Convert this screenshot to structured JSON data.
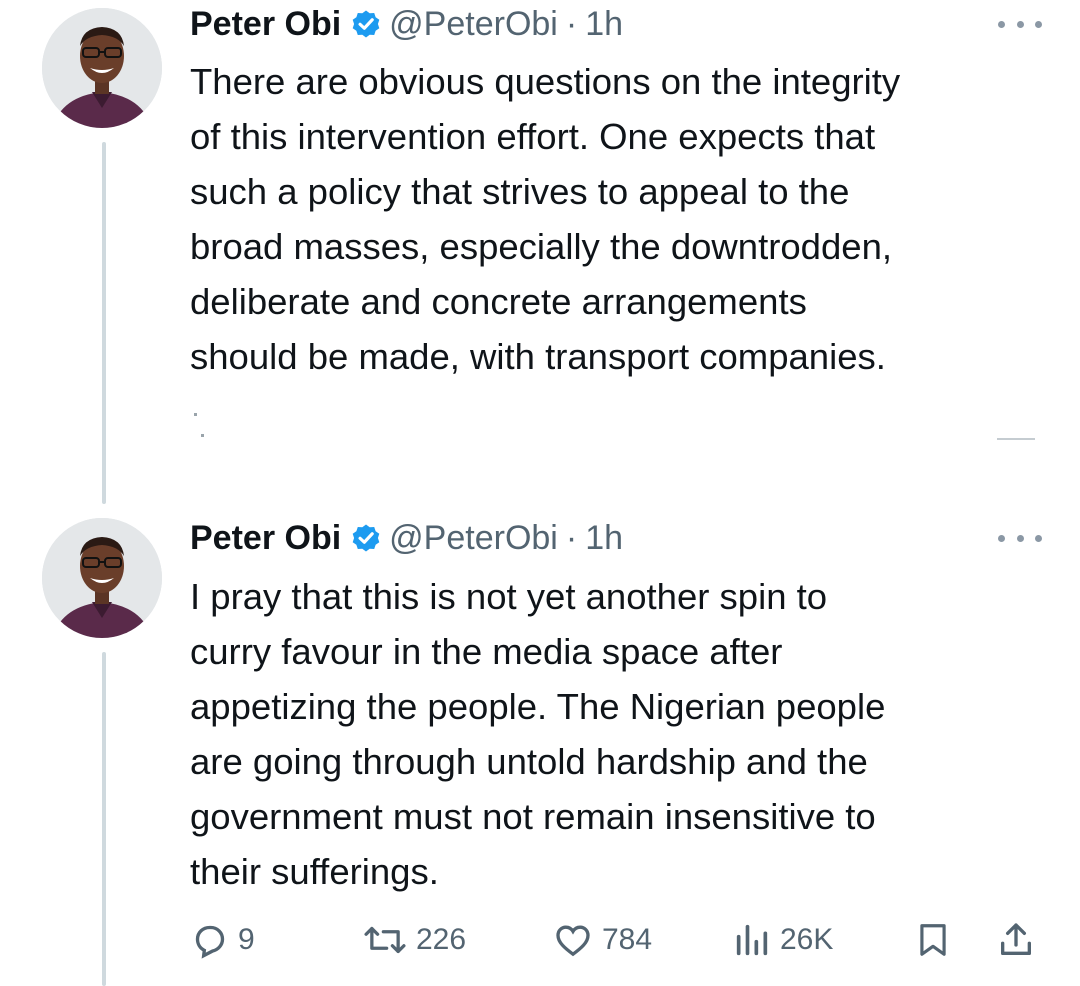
{
  "tweets": [
    {
      "name": "Peter Obi",
      "handle": "@PeterObi",
      "separator": "·",
      "time": "1h",
      "lines": [
        "There are obvious questions on the integrity",
        "of this intervention effort. One expects that",
        "such a policy that strives to appeal to the",
        "broad masses, especially the downtrodden,",
        "deliberate and concrete arrangements",
        "should be made, with transport companies."
      ]
    },
    {
      "name": "Peter Obi",
      "handle": "@PeterObi",
      "separator": "·",
      "time": "1h",
      "lines": [
        "I pray that this is not yet another spin to",
        "curry favour in the media space after",
        "appetizing the people. The Nigerian people",
        "are going through untold hardship and the",
        "government must not remain insensitive to",
        "their sufferings."
      ],
      "actions": {
        "replies": "9",
        "reposts": "226",
        "likes": "784",
        "views": "26K"
      }
    }
  ],
  "icons": {
    "verified": "verified-badge-icon",
    "more": "more-options-icon",
    "reply": "reply-icon",
    "repost": "repost-icon",
    "like": "like-icon",
    "views": "views-icon",
    "bookmark": "bookmark-icon",
    "share": "share-icon"
  },
  "colors": {
    "verified_blue": "#1d9bf0",
    "secondary_text": "#536471",
    "thread_line": "#cfd9de"
  }
}
